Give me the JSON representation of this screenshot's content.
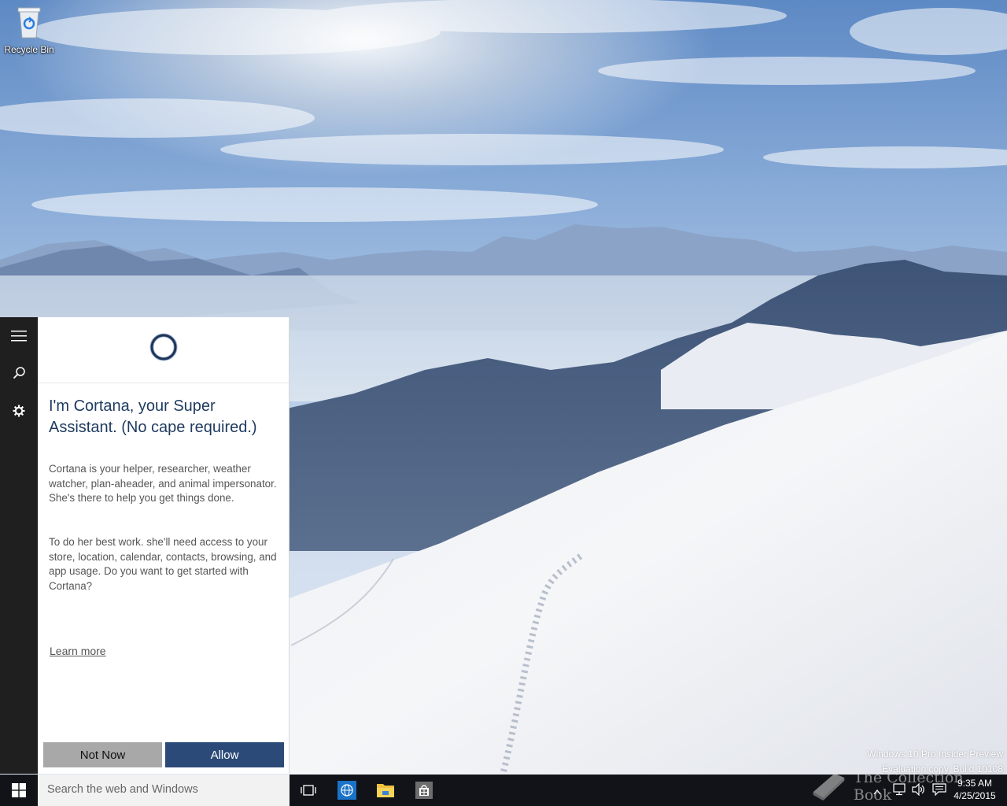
{
  "desktop": {
    "recycle_bin_label": "Recycle Bin"
  },
  "cortana": {
    "headline": "I'm Cortana, your Super Assistant. (No cape required.)",
    "paragraph1": "Cortana is your helper, researcher, weather watcher, plan-aheader, and animal impersonator. She's there to help you get things done.",
    "paragraph2": "To do her best work. she'll need access to your store, location, calendar, contacts, browsing, and app usage. Do you want to get started with Cortana?",
    "learn_more": "Learn more",
    "not_now_label": "Not Now",
    "allow_label": "Allow",
    "rail_icons": [
      "hamburger-icon",
      "search-icon",
      "gear-icon"
    ]
  },
  "taskbar": {
    "search_placeholder": "Search the web and Windows",
    "icons": [
      "windows-start-icon",
      "task-view-icon",
      "ie-icon",
      "file-explorer-icon",
      "store-icon"
    ],
    "clock_time": "9:35 AM",
    "clock_date": "4/25/2015"
  },
  "watermark": {
    "line1": "Windows 10 Pro Insider Preview",
    "line2": "Evaluation copy. Build 10108",
    "brand": "The Collection Book"
  },
  "colors": {
    "accent": "#2b4a78",
    "rail_bg": "#1f1f1f",
    "taskbar_bg": "#111318"
  }
}
